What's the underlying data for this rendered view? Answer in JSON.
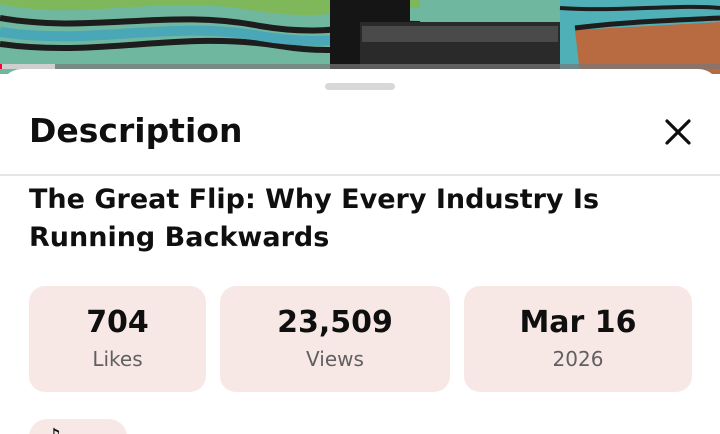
{
  "sheet": {
    "title": "Description",
    "close_icon": "close-icon"
  },
  "video": {
    "title": "The Great Flip: Why Every Industry Is Running Backwards",
    "progress_fraction": 0.003,
    "buffered_fraction": 0.076
  },
  "stats": [
    {
      "value": "704",
      "label": "Likes"
    },
    {
      "value": "23,509",
      "label": "Views"
    },
    {
      "value": "Mar 16",
      "label": "2026"
    }
  ],
  "chip": {
    "icon": "music-note-icon"
  },
  "colors": {
    "card_background": "#f8e8e5",
    "progress_played": "#ff0033",
    "text_primary": "#0f0f0f",
    "text_secondary": "#606060"
  }
}
